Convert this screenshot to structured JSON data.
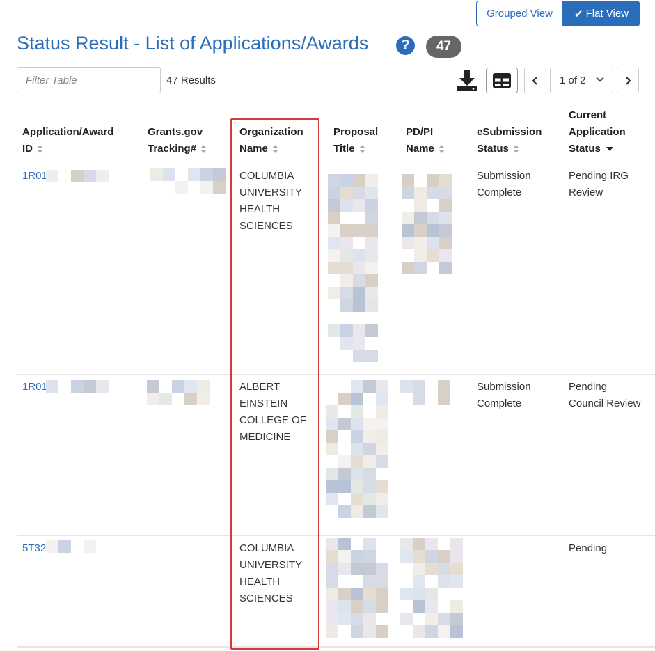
{
  "view_toggle": {
    "grouped": "Grouped View",
    "flat": "Flat View"
  },
  "title": "Status Result - List of Applications/Awards",
  "count_badge": "47",
  "filter": {
    "placeholder": "Filter Table",
    "value": ""
  },
  "results_count": "47 Results",
  "pager": {
    "current": "1 of 2"
  },
  "columns": {
    "app_id": [
      "Application/Award",
      "ID"
    ],
    "tracking": [
      "Grants.gov",
      "Tracking#"
    ],
    "org": [
      "Organization",
      "Name"
    ],
    "title": [
      "Proposal",
      "Title"
    ],
    "pi": [
      "PD/PI",
      "Name"
    ],
    "esub": [
      "eSubmission",
      "Status"
    ],
    "status": [
      "Current",
      "Application",
      "Status"
    ]
  },
  "rows": [
    {
      "app_id": "1R01",
      "org": [
        "COLUMBIA",
        "UNIVERSITY",
        "HEALTH",
        "SCIENCES"
      ],
      "esub": [
        "Submission",
        "Complete"
      ],
      "status": [
        "Pending IRG",
        "Review"
      ]
    },
    {
      "app_id": "1R01",
      "org": [
        "ALBERT",
        "EINSTEIN",
        "COLLEGE OF",
        "MEDICINE"
      ],
      "esub": [
        "Submission",
        "Complete"
      ],
      "status": [
        "Pending",
        "Council Review"
      ]
    },
    {
      "app_id": "5T32",
      "org": [
        "COLUMBIA",
        "UNIVERSITY",
        "HEALTH",
        "SCIENCES"
      ],
      "esub": [
        "",
        ""
      ],
      "status": [
        "Pending",
        ""
      ]
    }
  ],
  "colors": {
    "accent": "#2a6ebb",
    "highlight": "#d9383a",
    "badge": "#666666"
  }
}
